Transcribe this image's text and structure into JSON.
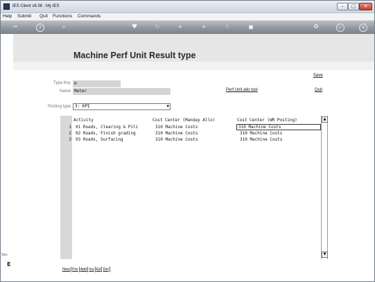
{
  "window": {
    "title": "IES Client v8.36 : My IES",
    "min": "–",
    "max": "□",
    "close": "✕"
  },
  "menu": [
    "Help",
    "Submit",
    "Quit",
    "Functions",
    "Commands"
  ],
  "toolbar": {
    "icons": [
      "key-icon",
      "help-icon",
      "search-icon",
      "heart-icon",
      "refresh-icon",
      "back-icon",
      "forward-icon",
      "upload-icon",
      "stop-icon",
      "settings-icon",
      "check-icon",
      "close-icon"
    ],
    "glyphs": {
      "key": "⊸",
      "help": "?",
      "search": "⌕",
      "heart": "♥",
      "refresh": "↻",
      "back": "«",
      "forward": "»",
      "upload": "⇧",
      "stop": "■",
      "settings": "⚙",
      "check": "✓",
      "close": "✕"
    }
  },
  "page": {
    "title": "Machine Perf Unit Result type"
  },
  "form": {
    "type_key_label": "Type Key",
    "type_key_value": "m",
    "name_label": "Name",
    "name_value": "Meter",
    "posting_type_label": "Posting type",
    "posting_type_value": "3: KPI"
  },
  "actions": {
    "save": "Save",
    "quit": "Quit",
    "perf_tool": "Perf Unit allo tool"
  },
  "grid": {
    "headers": [
      "Activity",
      "Cost Center (Manday Allo)",
      "Cost Center (WR Posting)"
    ],
    "rows": [
      {
        "num": "1",
        "activity": "91 Roads, Clearing & Pili",
        "cc_manday": "310 Machine Costs",
        "cc_wr": "310 Machine Costs"
      },
      {
        "num": "2",
        "activity": "92 Roads, Finish grading",
        "cc_manday": "310 Machine Costs",
        "cc_wr": "310 Machine Costs"
      },
      {
        "num": "3",
        "activity": "93 Roads, Surfacing",
        "cc_manday": "310 Machine Costs",
        "cc_wr": "310 Machine Costs"
      }
    ],
    "scroll_up": "▲",
    "scroll_down": "▼"
  },
  "grid_actions": [
    "New",
    "Pre",
    "Add",
    "Ins",
    "Ed",
    "Del"
  ],
  "left_strip": {
    "tag": "Ses",
    "mark": "E"
  }
}
